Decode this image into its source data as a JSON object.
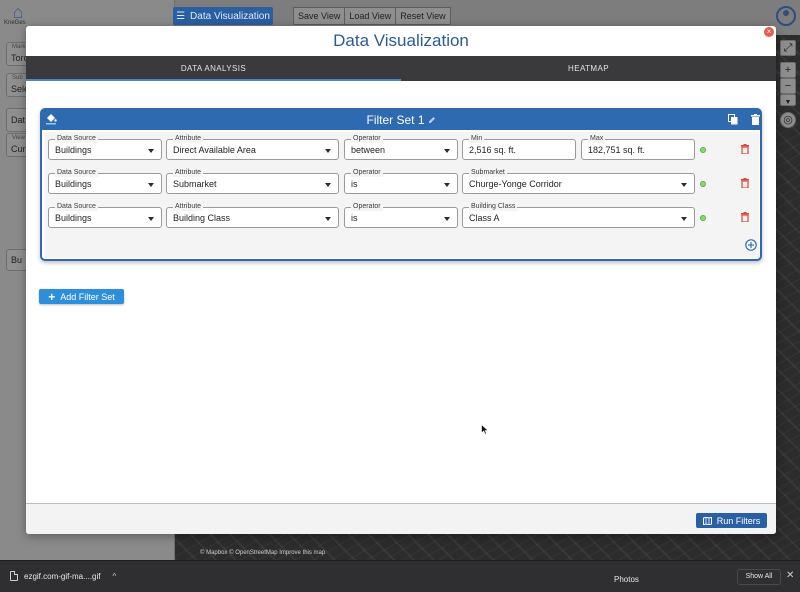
{
  "background": {
    "logo_label": "KneGes",
    "topbar": {
      "data_viz_button": "Data Visualization",
      "save_view": "Save View",
      "load_view": "Load View",
      "reset_view": "Reset View"
    },
    "sidebar_fields": [
      {
        "label": "Mark",
        "value": "Toro"
      },
      {
        "label": "Sub",
        "value": "Sele"
      },
      {
        "label": "",
        "value": "Dat"
      },
      {
        "label": "View",
        "value": "Curr"
      }
    ],
    "sidebar_button": "Bu",
    "map_attribution": "© Mapbox © OpenStreetMap  Improve this map"
  },
  "modal": {
    "title": "Data Visualization",
    "tabs": [
      {
        "label": "DATA ANALYSIS",
        "active": true
      },
      {
        "label": "HEATMAP",
        "active": false
      }
    ],
    "filter_set": {
      "title": "Filter Set 1",
      "rows": [
        {
          "data_source": {
            "label": "Data Source",
            "value": "Buildings"
          },
          "attribute": {
            "label": "Attribute",
            "value": "Direct Available Area"
          },
          "operator": {
            "label": "Operator",
            "value": "between"
          },
          "min": {
            "label": "Min",
            "value": "2,516 sq. ft."
          },
          "max": {
            "label": "Max",
            "value": "182,751 sq. ft."
          }
        },
        {
          "data_source": {
            "label": "Data Source",
            "value": "Buildings"
          },
          "attribute": {
            "label": "Attribute",
            "value": "Submarket"
          },
          "operator": {
            "label": "Operator",
            "value": "is"
          },
          "target": {
            "label": "Submarket",
            "value": "Churge-Yonge Corridor"
          }
        },
        {
          "data_source": {
            "label": "Data Source",
            "value": "Buildings"
          },
          "attribute": {
            "label": "Attribute",
            "value": "Building Class"
          },
          "operator": {
            "label": "Operator",
            "value": "is"
          },
          "target": {
            "label": "Building Class",
            "value": "Class A"
          }
        }
      ]
    },
    "add_filter_set_label": "Add Filter Set",
    "run_filters_label": "Run Filters"
  },
  "downloads_bar": {
    "file_name": "ezgif.com-gif-ma....gif",
    "photos_label": "Photos",
    "show_all_label": "Show All"
  },
  "colors": {
    "primary": "#2e6ab0",
    "accent_button": "#2d8fdb",
    "delete_red": "#e0443a",
    "status_green": "#5ab043"
  }
}
